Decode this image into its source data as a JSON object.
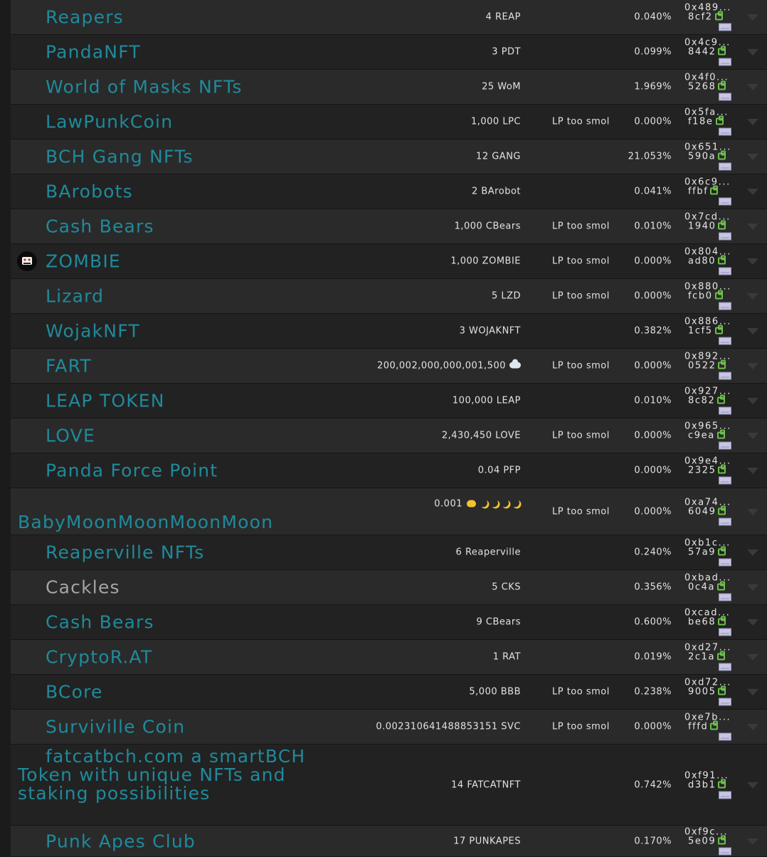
{
  "rows": [
    {
      "name": "Reapers",
      "balance": "4 REAP",
      "lp": "",
      "pct": "0.040%",
      "addr1": "0x489...",
      "addr2": "8cf2"
    },
    {
      "name": "PandaNFT",
      "balance": "3 PDT",
      "lp": "",
      "pct": "0.099%",
      "addr1": "0x4c9...",
      "addr2": "8442"
    },
    {
      "name": "World of Masks NFTs",
      "balance": "25 WoM",
      "lp": "",
      "pct": "1.969%",
      "addr1": "0x4f0...",
      "addr2": "5268"
    },
    {
      "name": "LawPunkCoin",
      "balance": "1,000 LPC",
      "lp": "LP too smol",
      "pct": "0.000%",
      "addr1": "0x5fa...",
      "addr2": "f18e"
    },
    {
      "name": "BCH Gang NFTs",
      "balance": "12 GANG",
      "lp": "",
      "pct": "21.053%",
      "addr1": "0x651...",
      "addr2": "590a"
    },
    {
      "name": "BArobots",
      "balance": "2 BArobot",
      "lp": "",
      "pct": "0.041%",
      "addr1": "0x6c9...",
      "addr2": "ffbf"
    },
    {
      "name": "Cash Bears",
      "balance": "1,000 CBears",
      "lp": "LP too smol",
      "pct": "0.010%",
      "addr1": "0x7cd...",
      "addr2": "1940"
    },
    {
      "name": "ZOMBIE",
      "balance": "1,000 ZOMBIE",
      "lp": "LP too smol",
      "pct": "0.000%",
      "addr1": "0x804...",
      "addr2": "ad80"
    },
    {
      "name": "Lizard",
      "balance": "5 LZD",
      "lp": "LP too smol",
      "pct": "0.000%",
      "addr1": "0x880...",
      "addr2": "fcb0"
    },
    {
      "name": "WojakNFT",
      "balance": "3 WOJAKNFT",
      "lp": "",
      "pct": "0.382%",
      "addr1": "0x886...",
      "addr2": "1cf5"
    },
    {
      "name": "FART",
      "balance": "200,002,000,000,001,500",
      "lp": "LP too smol",
      "pct": "0.000%",
      "addr1": "0x892...",
      "addr2": "0522"
    },
    {
      "name": "LEAP TOKEN",
      "balance": "100,000 LEAP",
      "lp": "",
      "pct": "0.010%",
      "addr1": "0x927...",
      "addr2": "8c82"
    },
    {
      "name": "LOVE",
      "balance": "2,430,450 LOVE",
      "lp": "LP too smol",
      "pct": "0.000%",
      "addr1": "0x965...",
      "addr2": "c9ea"
    },
    {
      "name": "Panda Force Point",
      "balance": "0.04 PFP",
      "lp": "",
      "pct": "0.000%",
      "addr1": "0x9e4...",
      "addr2": "2325"
    },
    {
      "name": "BabyMoonMoonMoonMoon",
      "balance": "0.001",
      "lp": "LP too smol",
      "pct": "0.000%",
      "addr1": "0xa74...",
      "addr2": "6049"
    },
    {
      "name": "Reaperville NFTs",
      "balance": "6 Reaperville",
      "lp": "",
      "pct": "0.240%",
      "addr1": "0xb1c...",
      "addr2": "57a9"
    },
    {
      "name": "Cackles",
      "balance": "5 CKS",
      "lp": "",
      "pct": "0.356%",
      "addr1": "0xbad...",
      "addr2": "0c4a"
    },
    {
      "name": "Cash Bears",
      "balance": "9 CBears",
      "lp": "",
      "pct": "0.600%",
      "addr1": "0xcad...",
      "addr2": "be68"
    },
    {
      "name": "CryptoR.AT",
      "balance": "1 RAT",
      "lp": "",
      "pct": "0.019%",
      "addr1": "0xd27...",
      "addr2": "2c1a"
    },
    {
      "name": "BCore",
      "balance": "5,000 BBB",
      "lp": "LP too smol",
      "pct": "0.238%",
      "addr1": "0xd72...",
      "addr2": "9005"
    },
    {
      "name": "Surviville Coin",
      "balance": "0.002310641488853151 SVC",
      "lp": "LP too smol",
      "pct": "0.000%",
      "addr1": "0xe7b...",
      "addr2": "fffd"
    },
    {
      "name": "fatcatbch.com a smartBCH Token with unique NFTs and staking possibilities",
      "balance": "14 FATCATNFT",
      "lp": "",
      "pct": "0.742%",
      "addr1": "0xf91...",
      "addr2": "d3b1"
    },
    {
      "name": "Punk Apes Club",
      "balance": "17 PUNKAPES",
      "lp": "",
      "pct": "0.170%",
      "addr1": "0xf9c...",
      "addr2": "5e09"
    }
  ],
  "colors": {
    "link": "#1f8a9b",
    "muted_name": "#a4a4a4",
    "copy_icon": "#6cc04a"
  }
}
